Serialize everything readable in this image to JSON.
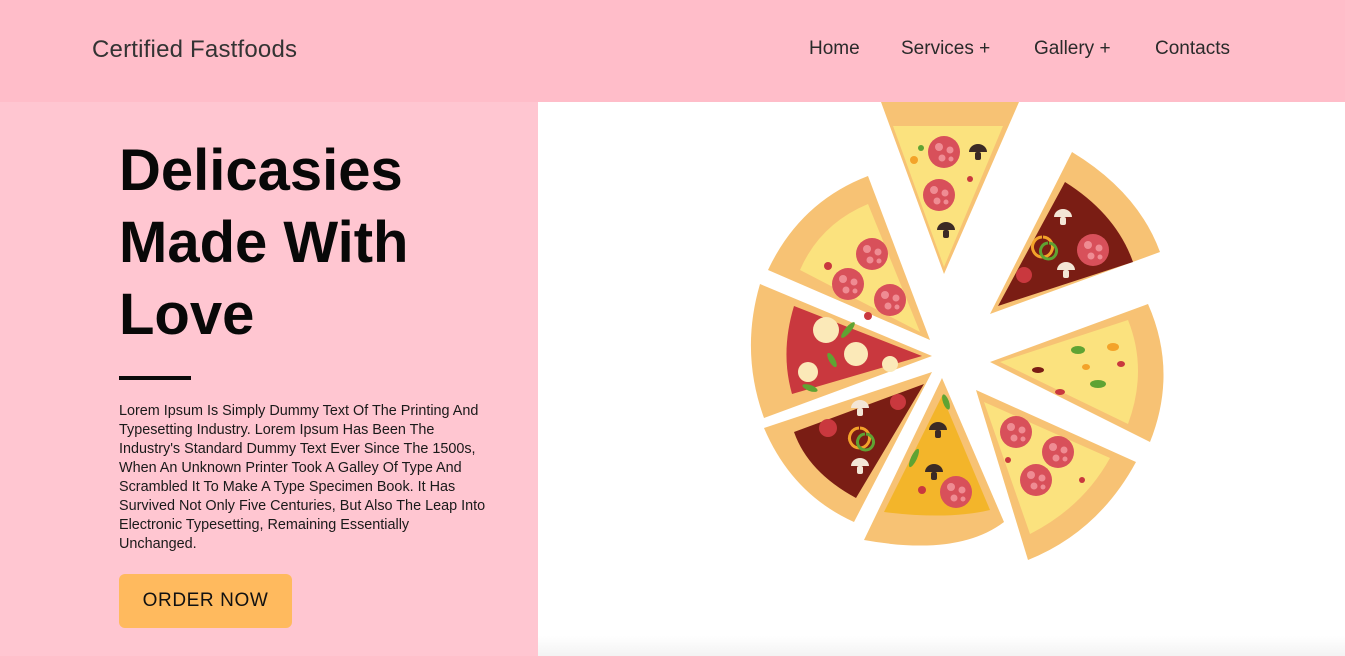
{
  "header": {
    "brand": "Certified Fastfoods",
    "nav": [
      {
        "label": "Home"
      },
      {
        "label": "Services +"
      },
      {
        "label": "Gallery +"
      },
      {
        "label": "Contacts"
      }
    ]
  },
  "hero": {
    "title_lines": [
      "Delicasies",
      "Made With",
      "Love"
    ],
    "description": "Lorem Ipsum Is Simply Dummy Text Of The Printing And Typesetting Industry. Lorem Ipsum Has Been The Industry's Standard Dummy Text Ever Since The 1500s, When An Unknown Printer Took A Galley Of Type And Scrambled It To Make A Type Specimen Book. It Has Survived Not Only Five Centuries, But Also The Leap Into Electronic Typesetting, Remaining Essentially Unchanged.",
    "cta_label": "ORDER NOW",
    "image_icon": "pizza-slices-illustration"
  },
  "colors": {
    "header_bg": "#ffbdc9",
    "hero_bg": "#ffc6d1",
    "cta_bg": "#ffba5e",
    "crust": "#f7c274",
    "sauce_red": "#c9383e",
    "sauce_dark": "#7a1d14",
    "cheese": "#fbe27e"
  }
}
